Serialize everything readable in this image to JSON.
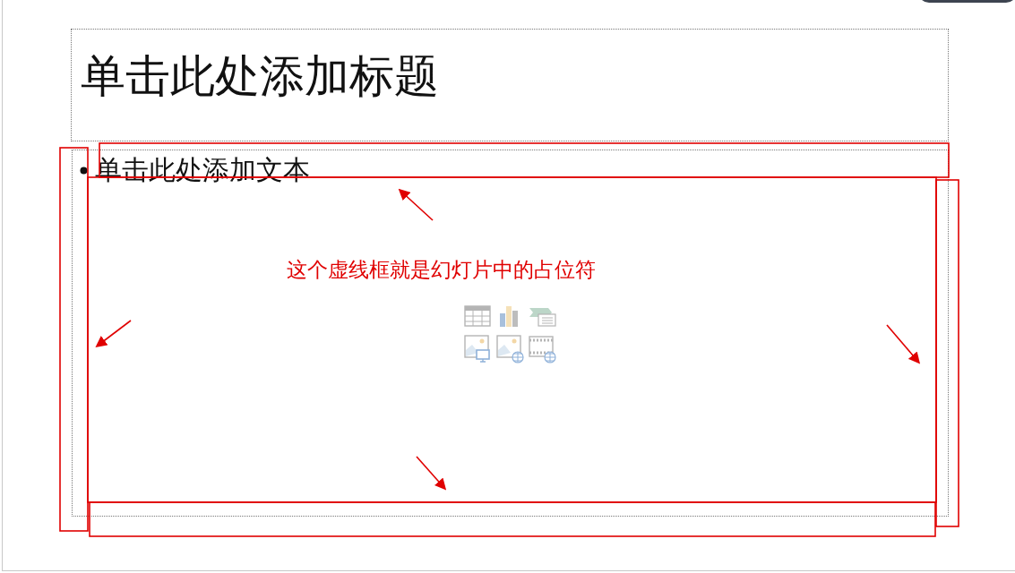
{
  "slide": {
    "title_placeholder": {
      "text": "单击此处添加标题"
    },
    "content_placeholder": {
      "bullets": [
        "单击此处添加文本"
      ],
      "insert_icons": [
        {
          "kind": "table"
        },
        {
          "kind": "chart"
        },
        {
          "kind": "smartart"
        },
        {
          "kind": "picture"
        },
        {
          "kind": "online-picture"
        },
        {
          "kind": "video"
        }
      ]
    },
    "annotation": {
      "text": "这个虚线框就是幻灯片中的占位符"
    }
  }
}
